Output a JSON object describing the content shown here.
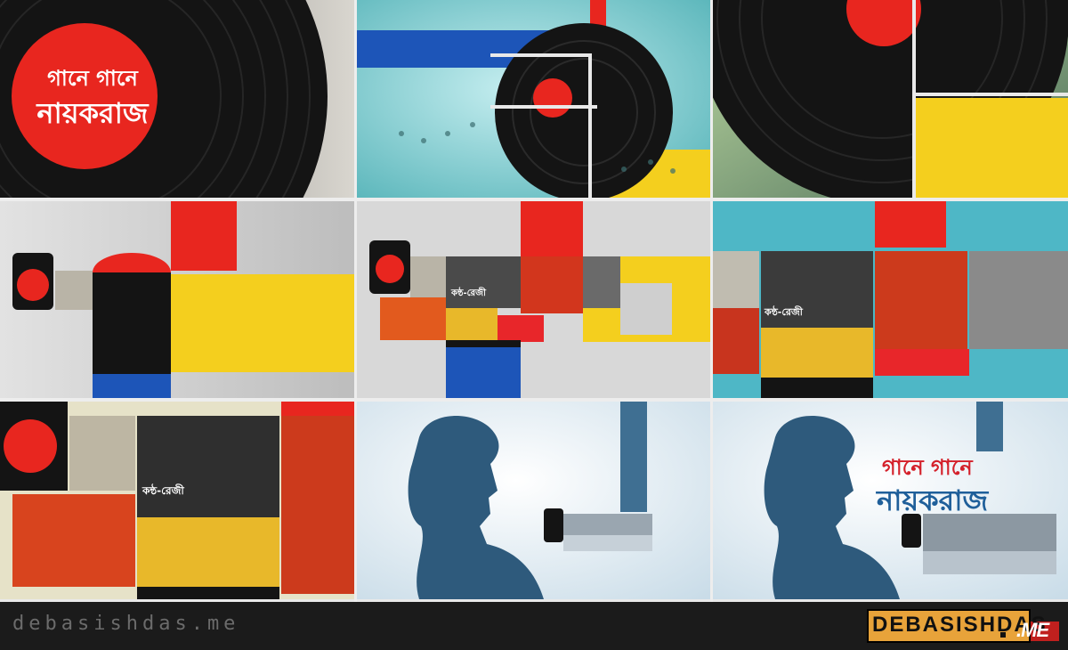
{
  "panels": [
    {
      "id": "title-card",
      "title_line1": "গানে গানে",
      "title_line2": "নায়করাজ"
    },
    {
      "id": "transition-blue-yellow"
    },
    {
      "id": "record-zoom-yellow"
    },
    {
      "id": "collage-record-yellow"
    },
    {
      "id": "collage-photos-a",
      "caption": "কন্ঠ-রেজী"
    },
    {
      "id": "collage-photos-b",
      "caption": "কন্ঠ-রেজী"
    },
    {
      "id": "collage-photos-c",
      "caption": "কন্ঠ-রেজী"
    },
    {
      "id": "portrait-silhouette"
    },
    {
      "id": "final-title",
      "title_line1": "গানে গানে",
      "title_line2": "নায়করাজ"
    }
  ],
  "colors": {
    "red": "#e8261f",
    "yellow": "#f4cf1e",
    "blue": "#1d55b8",
    "teal": "#7fd0d4",
    "vinyl": "#141414",
    "navy": "#2e5a7c"
  },
  "footer": {
    "url": "debasishdas.me",
    "logo_text": "DEBASISHDAS",
    "logo_suffix": ".ME"
  }
}
